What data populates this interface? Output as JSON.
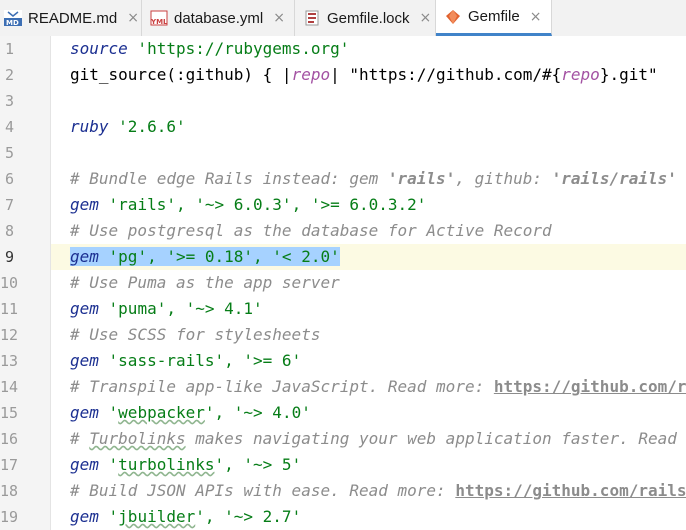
{
  "tabs": [
    {
      "label": "README.md",
      "icon": "md-file-icon",
      "active": false
    },
    {
      "label": "database.yml",
      "icon": "yml-file-icon",
      "active": false
    },
    {
      "label": "Gemfile.lock",
      "icon": "lock-file-icon",
      "active": false
    },
    {
      "label": "Gemfile",
      "icon": "gemfile-icon",
      "active": true
    }
  ],
  "tab_close_glyph": "×",
  "line_numbers": [
    "1",
    "2",
    "3",
    "4",
    "5",
    "6",
    "7",
    "8",
    "9",
    "10",
    "11",
    "12",
    "13",
    "14",
    "15",
    "16",
    "17",
    "18",
    "19"
  ],
  "current_line": "9",
  "lines": [
    [
      {
        "t": "source",
        "c": "kw"
      },
      {
        "t": " 'https://rubygems.org'",
        "c": "str"
      }
    ],
    [
      {
        "t": "git_source(:github) { |",
        "c": ""
      },
      {
        "t": "repo",
        "c": "param"
      },
      {
        "t": "| \"https://github.com/#{",
        "c": ""
      },
      {
        "t": "repo",
        "c": "param"
      },
      {
        "t": "}.git\"",
        "c": ""
      }
    ],
    [],
    [
      {
        "t": "ruby",
        "c": "kw"
      },
      {
        "t": " '2.6.6'",
        "c": "str"
      }
    ],
    [],
    [
      {
        "t": "# Bundle edge Rails instead: gem ",
        "c": "cm"
      },
      {
        "t": "'rails'",
        "c": "cmb"
      },
      {
        "t": ", github: ",
        "c": "cm"
      },
      {
        "t": "'rails/rails'",
        "c": "cmb"
      }
    ],
    [
      {
        "t": "gem",
        "c": "kw"
      },
      {
        "t": " 'rails', '~> 6.0.3', '>= 6.0.3.2'",
        "c": "str"
      }
    ],
    [
      {
        "t": "# Use postgresql as the database for Active Record",
        "c": "cm"
      }
    ],
    [
      {
        "t": "gem",
        "c": "kw sel"
      },
      {
        "t": " 'pg', '>= 0.18', '< 2.0'",
        "c": "str sel"
      }
    ],
    [
      {
        "t": "# Use Puma as the app server",
        "c": "cm"
      }
    ],
    [
      {
        "t": "gem",
        "c": "kw"
      },
      {
        "t": " 'puma', '~> 4.1'",
        "c": "str"
      }
    ],
    [
      {
        "t": "# Use SCSS for stylesheets",
        "c": "cm"
      }
    ],
    [
      {
        "t": "gem",
        "c": "kw"
      },
      {
        "t": " 'sass-rails', '>= 6'",
        "c": "str"
      }
    ],
    [
      {
        "t": "# Transpile app-like JavaScript. Read more: ",
        "c": "cm"
      },
      {
        "t": "https://github.com/rails/webpacker",
        "c": "url"
      }
    ],
    [
      {
        "t": "gem",
        "c": "kw"
      },
      {
        "t": " '",
        "c": "str"
      },
      {
        "t": "webpacker",
        "c": "str sq"
      },
      {
        "t": "', '~> 4.0'",
        "c": "str"
      }
    ],
    [
      {
        "t": "# ",
        "c": "cm"
      },
      {
        "t": "Turbolinks",
        "c": "cm sq"
      },
      {
        "t": " makes navigating your web application faster. Read more",
        "c": "cm"
      }
    ],
    [
      {
        "t": "gem",
        "c": "kw"
      },
      {
        "t": " '",
        "c": "str"
      },
      {
        "t": "turbolinks",
        "c": "str sq"
      },
      {
        "t": "', '~> 5'",
        "c": "str"
      }
    ],
    [
      {
        "t": "# Build JSON APIs with ease. Read more: ",
        "c": "cm"
      },
      {
        "t": "https://github.com/rails/jbuilder",
        "c": "url"
      }
    ],
    [
      {
        "t": "gem",
        "c": "kw"
      },
      {
        "t": " '",
        "c": "str"
      },
      {
        "t": "jbuilder",
        "c": "str sq"
      },
      {
        "t": "', '~> 2.7'",
        "c": "str"
      }
    ]
  ],
  "colors": {
    "keyword": "#1b2f91",
    "string": "#067d17",
    "comment": "#8c8c8c",
    "param": "#a352a3",
    "selection": "#a6d2ff",
    "caret_line": "#fcfae3",
    "active_tab_underline": "#4083c9"
  }
}
